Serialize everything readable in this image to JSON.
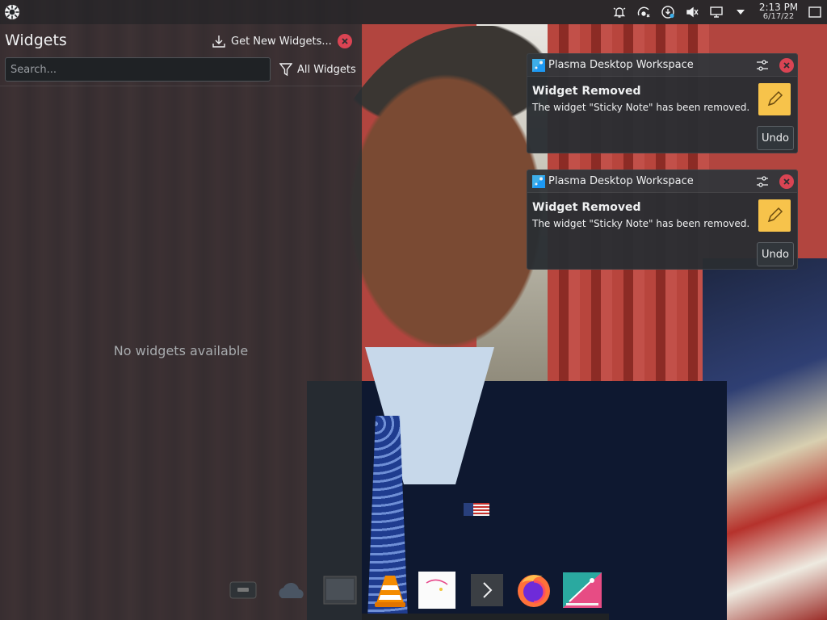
{
  "panel": {
    "clock_time": "2:13 PM",
    "clock_date": "6/17/22",
    "icons": [
      "app-launcher-icon",
      "notification-bell-icon",
      "network-status-icon",
      "updates-icon",
      "volume-muted-icon",
      "display-config-icon",
      "tray-expand-arrow-icon",
      "show-desktop-icon"
    ]
  },
  "widget_explorer": {
    "title": "Widgets",
    "get_new_label": "Get New Widgets...",
    "search_placeholder": "Search...",
    "filter_label": "All Widgets",
    "empty_message": "No widgets available"
  },
  "notifications": [
    {
      "app_name": "Plasma Desktop Workspace",
      "title": "Widget Removed",
      "body": "The widget \"Sticky Note\" has been removed.",
      "action_label": "Undo"
    },
    {
      "app_name": "Plasma Desktop Workspace",
      "title": "Widget Removed",
      "body": "The widget \"Sticky Note\" has been removed.",
      "action_label": "Undo"
    }
  ],
  "dock": {
    "items": [
      "window-thumbnail-icon",
      "cloud-icon",
      "window-thumbnail-icon",
      "vlc-icon",
      "image-viewer-icon",
      "more-arrow-icon",
      "firefox-icon",
      "plasma-icon"
    ]
  },
  "colors": {
    "panel_bg": "#232629",
    "accent_close": "#da4453",
    "sticky_note": "#f7c34b"
  }
}
